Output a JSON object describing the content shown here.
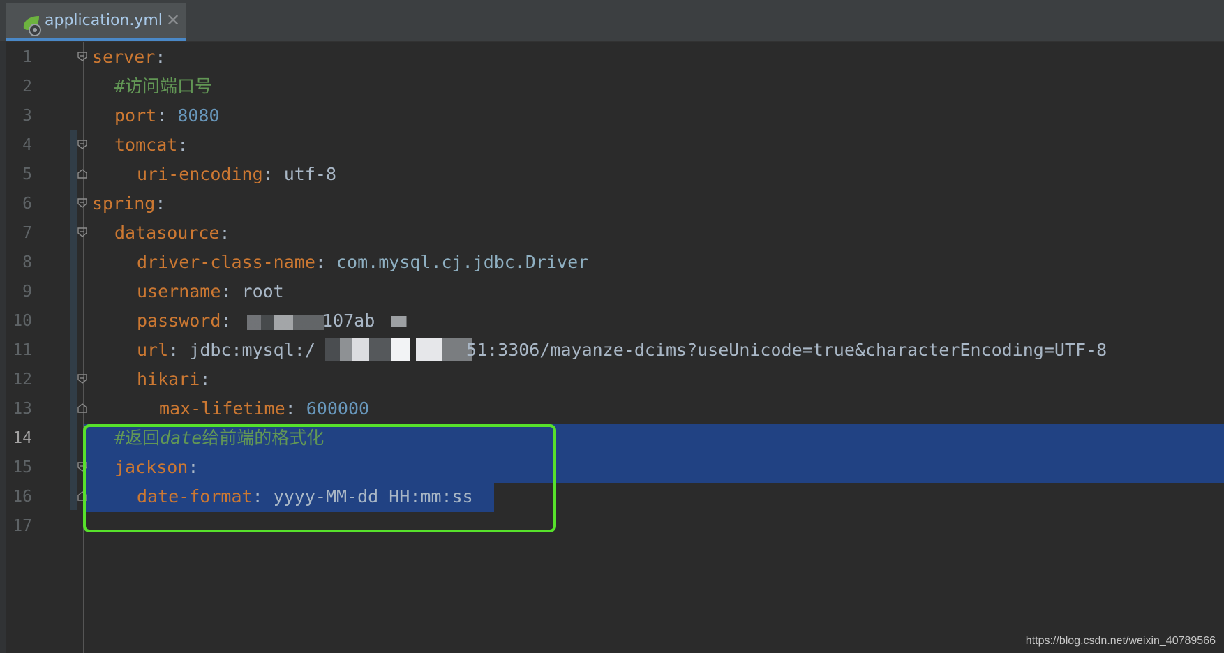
{
  "tab": {
    "filename": "application.yml",
    "icon": "spring-leaf-gear-icon",
    "close_icon": "close-x-icon"
  },
  "colors": {
    "key": "#cc7832",
    "number": "#6897bb",
    "comment": "#629755",
    "selection": "#214283",
    "highlight_box": "#57e12b"
  },
  "lines": [
    {
      "n": "1",
      "key": "server",
      "colon": ":"
    },
    {
      "n": "2",
      "comment": "#访问端口号"
    },
    {
      "n": "3",
      "key": "port",
      "colon": ": ",
      "value": "8080"
    },
    {
      "n": "4",
      "key": "tomcat",
      "colon": ":"
    },
    {
      "n": "5",
      "key": "uri-encoding",
      "colon": ": ",
      "value": "utf-8"
    },
    {
      "n": "6",
      "key": "spring",
      "colon": ":"
    },
    {
      "n": "7",
      "key": "datasource",
      "colon": ":"
    },
    {
      "n": "8",
      "key": "driver-class-name",
      "colon": ": ",
      "value": "com.mysql.cj.jdbc.Driver"
    },
    {
      "n": "9",
      "key": "username",
      "colon": ": ",
      "value": "root"
    },
    {
      "n": "10",
      "key": "password",
      "colon": ": ",
      "value": "107ab"
    },
    {
      "n": "11",
      "key": "url",
      "colon": ": ",
      "value_a": "jdbc:mysql:/",
      "value_b": "51:3306/mayanze-dcims?useUnicode=true&characterEncoding=UTF-8"
    },
    {
      "n": "12",
      "key": "hikari",
      "colon": ":"
    },
    {
      "n": "13",
      "key": "max-lifetime",
      "colon": ": ",
      "value": "600000"
    },
    {
      "n": "14",
      "comment_a": "#返回",
      "comment_b": "date",
      "comment_c": "给前端的格式化"
    },
    {
      "n": "15",
      "key": "jackson",
      "colon": ":"
    },
    {
      "n": "16",
      "key": "date-format",
      "colon": ": ",
      "value": "yyyy-MM-dd HH:mm:ss"
    },
    {
      "n": "17"
    }
  ],
  "watermark": "https://blog.csdn.net/weixin_40789566"
}
